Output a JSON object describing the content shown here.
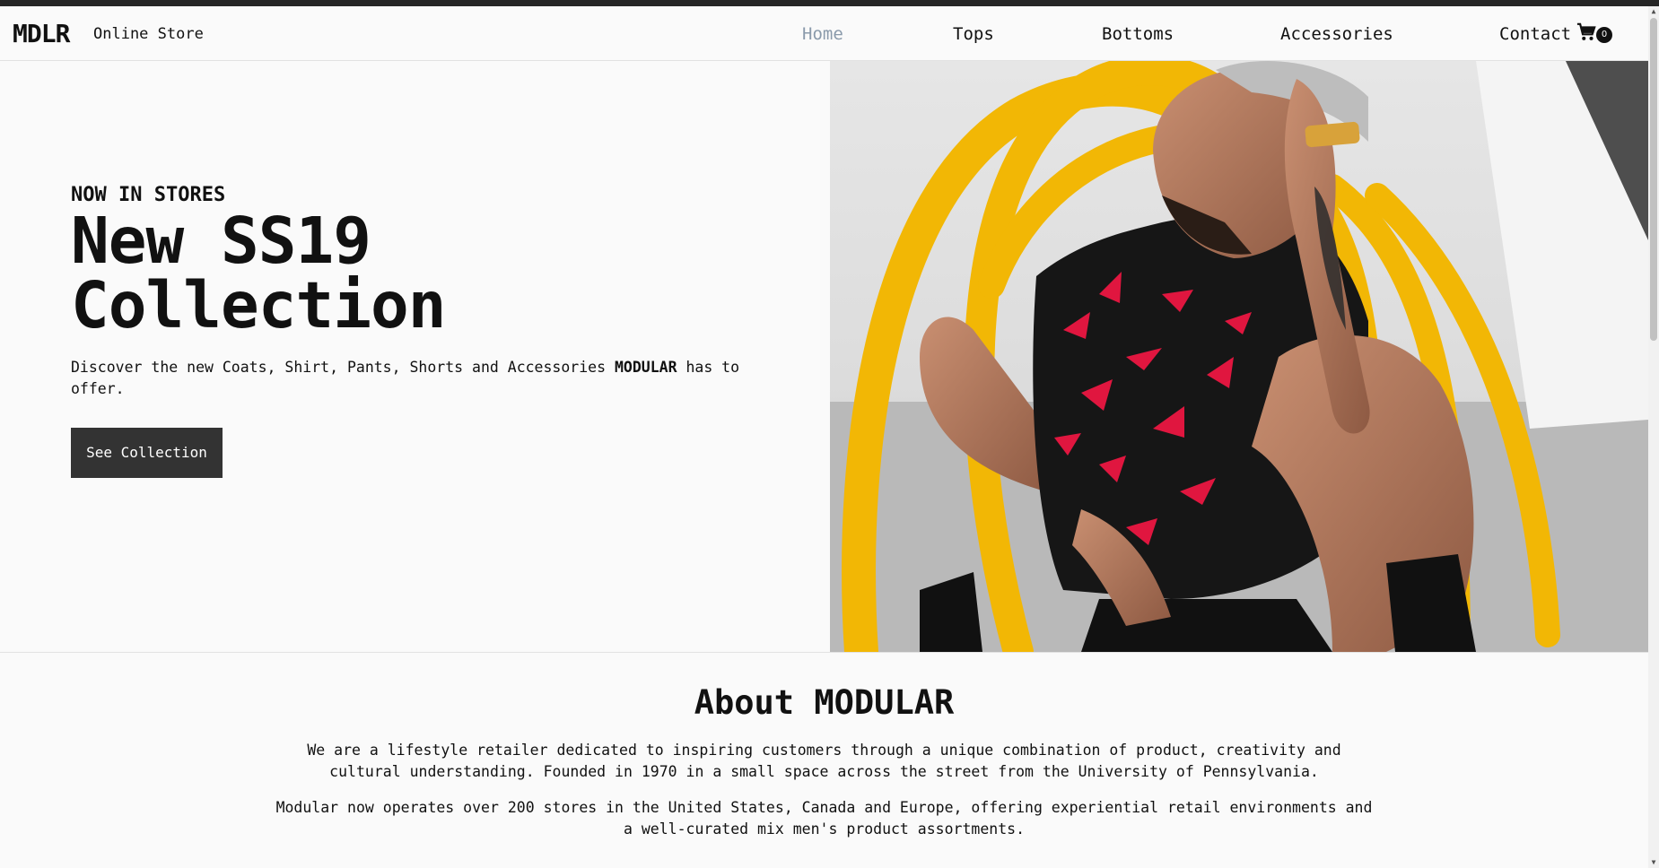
{
  "brand": {
    "logo": "MDLR",
    "tagline": "Online Store"
  },
  "nav": {
    "items": [
      {
        "label": "Home",
        "active": true
      },
      {
        "label": "Tops"
      },
      {
        "label": "Bottoms"
      },
      {
        "label": "Accessories"
      },
      {
        "label": "Contact"
      }
    ],
    "cart_count": "0"
  },
  "hero": {
    "eyebrow": "NOW IN STORES",
    "headline_line1": "New SS19",
    "headline_line2": "Collection",
    "description_before": "Discover the new Coats, Shirt, Pants, Shorts and Accessories ",
    "description_brand": "MODULAR",
    "description_after": " has to offer.",
    "cta_label": "See Collection"
  },
  "about": {
    "title": "About MODULAR",
    "paragraph1": "We are a lifestyle retailer dedicated to inspiring customers through a unique combination of product, creativity and cultural understanding. Founded in 1970 in a small space across the street from the University of Pennsylvania.",
    "paragraph2": "Modular now operates over 200 stores in the United States, Canada and Europe, offering experiential retail environments and a well-curated mix men's product assortments."
  },
  "colors": {
    "nav_active": "#8a9aab",
    "button_bg": "#333333",
    "accent_yellow": "#f2b705",
    "shirt_red": "#e0163f"
  }
}
